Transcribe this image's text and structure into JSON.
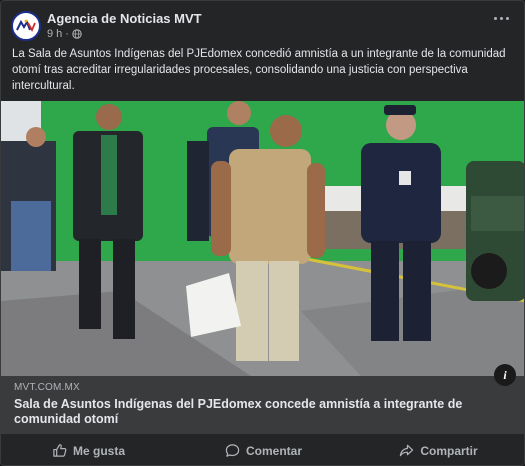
{
  "post": {
    "page_name": "Agencia de Noticias MVT",
    "time": "9 h",
    "separator": "·",
    "caption": "La Sala de Asuntos Indígenas del PJEdomex concedió amnistía a un integrante de la comunidad otomí tras acreditar irregularidades procesales, consolidando una justicia con perspectiva intercultural."
  },
  "link": {
    "domain": "MVT.COM.MX",
    "title": "Sala de Asuntos Indígenas del PJEdomex concede amnistía a integrante de comunidad otomí",
    "info_glyph": "i"
  },
  "actions": {
    "like": "Me gusta",
    "comment": "Comentar",
    "share": "Compartir"
  },
  "icons": {
    "avatar": "mvt-logo-icon",
    "privacy": "globe-icon",
    "more": "more-options-icon",
    "like": "thumbs-up-icon",
    "comment": "comment-bubble-icon",
    "share": "share-arrow-icon"
  },
  "colors": {
    "card_bg": "#242526",
    "text_primary": "#e4e6eb",
    "text_secondary": "#b0b3b8",
    "link_bg": "#3a3b3c",
    "photo_wall_green": "#2ea84a"
  }
}
